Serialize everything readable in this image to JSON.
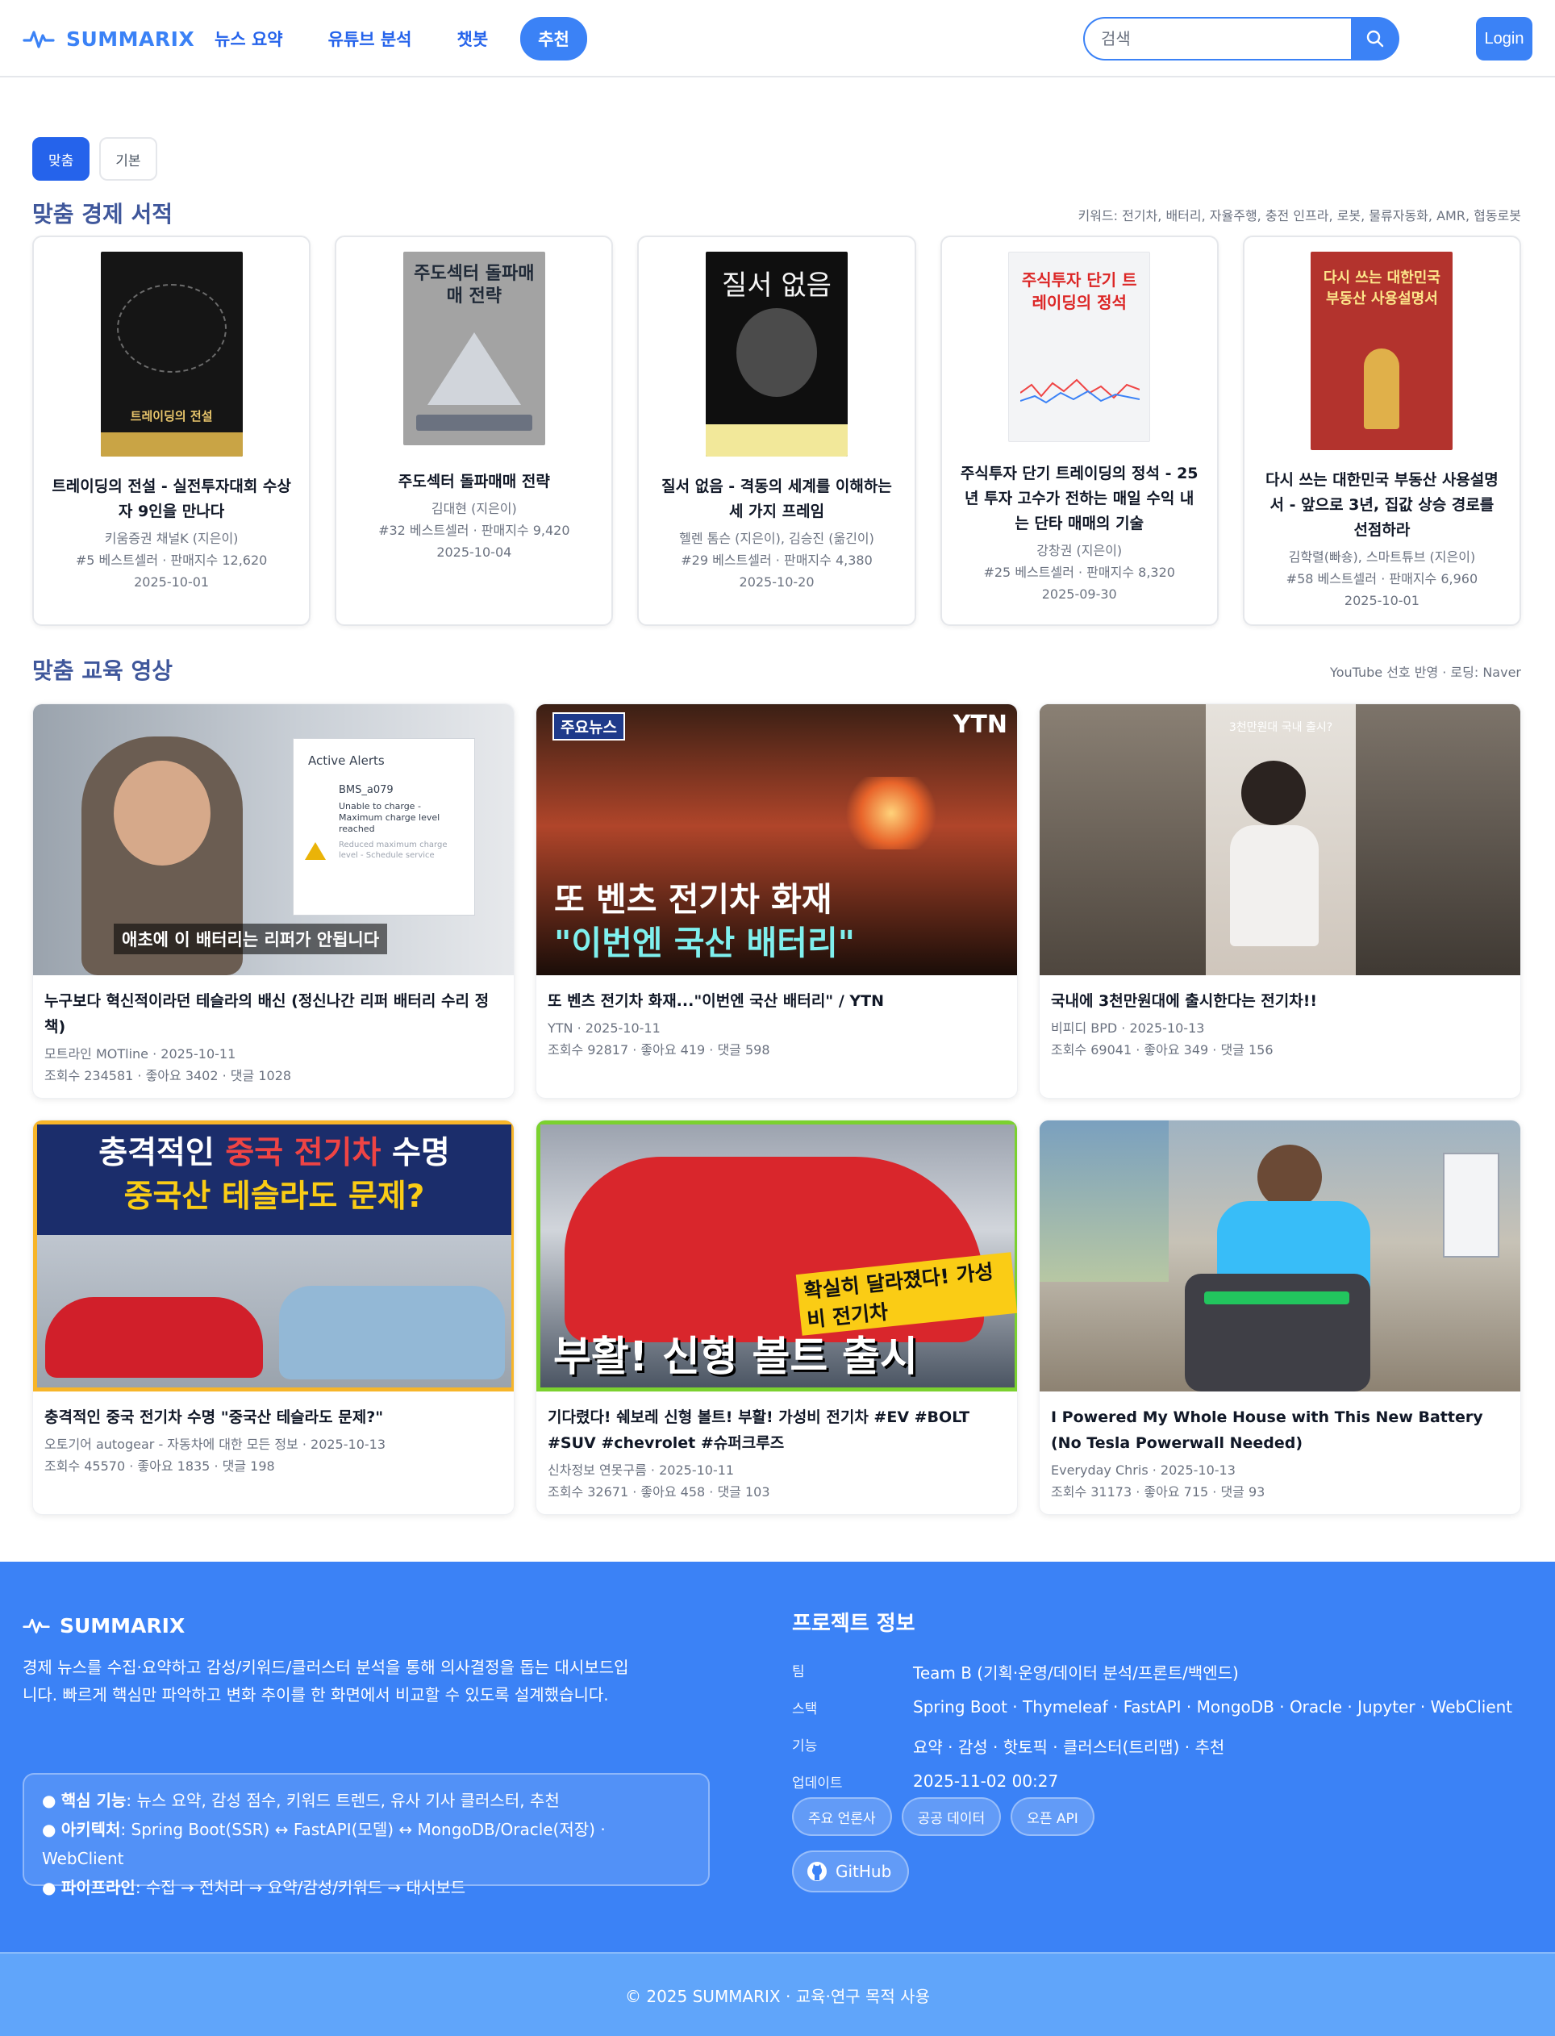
{
  "nav": {
    "brand": "SUMMARIX",
    "links": [
      "뉴스 요약",
      "유튜브 분석",
      "챗봇",
      "추천"
    ],
    "active_index": 3,
    "search_placeholder": "검색",
    "login": "Login"
  },
  "toggle": {
    "options": [
      "맞춤",
      "기본"
    ],
    "active": "맞춤"
  },
  "books_section": {
    "title": "맞춤 경제 서적",
    "keywords": "키워드: 전기차, 배터리, 자율주행, 충전 인프라, 로봇, 물류자동화, AMR, 협동로봇",
    "items": [
      {
        "title": "트레이딩의 전설 - 실전투자대회 수상자 9인을 만나다",
        "author": "키움증권 채널K (지은이)",
        "rank": "#5 베스트셀러 · 판매지수 12,620",
        "date": "2025-10-01",
        "cover_text": "트레이딩의 전설",
        "cover_bg": "#1a1a1a",
        "cover_fg": "#e8c56b"
      },
      {
        "title": "주도섹터 돌파매매 전략",
        "author": "김대현 (지은이)",
        "rank": "#32 베스트셀러 · 판매지수 9,420",
        "date": "2025-10-04",
        "cover_text": "주도섹터 돌파매매 전략",
        "cover_bg": "#9ca3af",
        "cover_fg": "#1f2937"
      },
      {
        "title": "질서 없음 - 격동의 세계를 이해하는 세 가지 프레임",
        "author": "헬렌 톰슨 (지은이), 김승진 (옮긴이)",
        "rank": "#29 베스트셀러 · 판매지수 4,380",
        "date": "2025-10-20",
        "cover_text": "질서 없음",
        "cover_bg": "#111111",
        "cover_fg": "#f5f5f5"
      },
      {
        "title": "주식투자 단기 트레이딩의 정석 - 25년 투자 고수가 전하는 매일 수익 내는 단타 매매의 기술",
        "author": "강창권 (지은이)",
        "rank": "#25 베스트셀러 · 판매지수 8,320",
        "date": "2025-09-30",
        "cover_text": "주식투자 단기 트레이딩의 정석",
        "cover_bg": "#f3f4f6",
        "cover_fg": "#dc2626"
      },
      {
        "title": "다시 쓰는 대한민국 부동산 사용설명서 - 앞으로 3년, 집값 상승 경로를 선점하라",
        "author": "김학렬(빠숑), 스마트튜브 (지은이)",
        "rank": "#58 베스트셀러 · 판매지수 6,960",
        "date": "2025-10-01",
        "cover_text": "다시 쓰는 대한민국 부동산 사용설명서",
        "cover_bg": "#b3332d",
        "cover_fg": "#fde68a"
      }
    ]
  },
  "videos_section": {
    "title": "맞춤 교육 영상",
    "note": "YouTube 선호 반영 · 로딩: Naver",
    "items": [
      {
        "title": "누구보다 혁신적이라던 테슬라의 배신 (정신나간 리퍼 배터리 수리 정책)",
        "channel_date": "모트라인 MOTline · 2025-10-11",
        "stats": "조회수 234581 · 좋아요 3402 · 댓글 1028",
        "thumb_caption": "애초에 이 배터리는 리퍼가 안됩니다",
        "thumb_alert_title": "Active Alerts",
        "thumb_alert_code": "BMS_a079",
        "thumb_alert_body": "Unable to charge - Maximum charge level reached",
        "thumb_alert_sub": "Reduced maximum charge level - Schedule service"
      },
      {
        "title": "또 벤츠 전기차 화재...\"이번엔 국산 배터리\" / YTN",
        "channel_date": "YTN · 2025-10-11",
        "stats": "조회수 92817 · 좋아요 419 · 댓글 598",
        "thumb_badge": "주요뉴스",
        "thumb_logo": "YTN",
        "thumb_line1": "또 벤츠 전기차 화재",
        "thumb_line2": "\"이번엔 국산 배터리\""
      },
      {
        "title": "국내에 3천만원대에 출시한다는 전기차!!",
        "channel_date": "비피디 BPD · 2025-10-13",
        "stats": "조회수 69041 · 좋아요 349 · 댓글 156",
        "thumb_caption": "3천만원대 국내 출시?"
      },
      {
        "title": "충격적인 중국 전기차 수명 \"중국산 테슬라도 문제?\"",
        "channel_date": "오토기어 autogear - 자동차에 대한 모든 정보 · 2025-10-13",
        "stats": "조회수 45570 · 좋아요 1835 · 댓글 198",
        "thumb_line1a": "충격적인 ",
        "thumb_line1b": "중국 전기차",
        "thumb_line1c": " 수명",
        "thumb_line2": "중국산 테슬라도 문제?"
      },
      {
        "title": "기다렸다! 쉐보레 신형 볼트! 부활! 가성비 전기차 #EV #BOLT #SUV #chevrolet #슈퍼크루즈",
        "channel_date": "신차정보 연못구름 · 2025-10-11",
        "stats": "조회수 32671 · 좋아요 458 · 댓글 103",
        "thumb_tag": "확실히 달라졌다! 가성비 전기차",
        "thumb_big": "부활! 신형 볼트 출시"
      },
      {
        "title": "I Powered My Whole House with This New Battery (No Tesla Powerwall Needed)",
        "channel_date": "Everyday Chris · 2025-10-13",
        "stats": "조회수 31173 · 좋아요 715 · 댓글 93"
      }
    ]
  },
  "footer": {
    "brand": "SUMMARIX",
    "description": "경제 뉴스를 수집·요약하고 감성/키워드/클러스터 분석을 통해 의사결정을 돕는 대시보드입니다. 빠르게 핵심만 파악하고 변화 추이를 한 화면에서 비교할 수 있도록 설계했습니다.",
    "features": [
      {
        "label": "핵심 기능",
        "text": ": 뉴스 요약, 감성 점수, 키워드 트렌드, 유사 기사 클러스터, 추천"
      },
      {
        "label": "아키텍처",
        "text": ": Spring Boot(SSR) ↔ FastAPI(모델) ↔ MongoDB/Oracle(저장) · WebClient"
      },
      {
        "label": "파이프라인",
        "text": ": 수집 → 전처리 → 요약/감성/키워드 → 대시보드"
      }
    ],
    "project_title": "프로젝트 정보",
    "project_rows": [
      {
        "label": "팀",
        "value": "Team B (기획·운영/데이터 분석/프론트/백엔드)"
      },
      {
        "label": "스택",
        "value": "Spring Boot · Thymeleaf · FastAPI · MongoDB · Oracle · Jupyter · WebClient"
      },
      {
        "label": "기능",
        "value": "요약 · 감성 · 핫토픽 · 클러스터(트리맵) · 추천"
      },
      {
        "label": "업데이트",
        "value": "2025-11-02 00:27"
      }
    ],
    "chips": [
      "주요 언론사",
      "공공 데이터",
      "오픈 API"
    ],
    "github": "GitHub",
    "copyright": "© 2025 SUMMARIX · 교육·연구 목적 사용"
  },
  "colors": {
    "primary": "#3b82f6",
    "primary_dark": "#2563eb",
    "footer_bottom": "#60a5fa"
  }
}
